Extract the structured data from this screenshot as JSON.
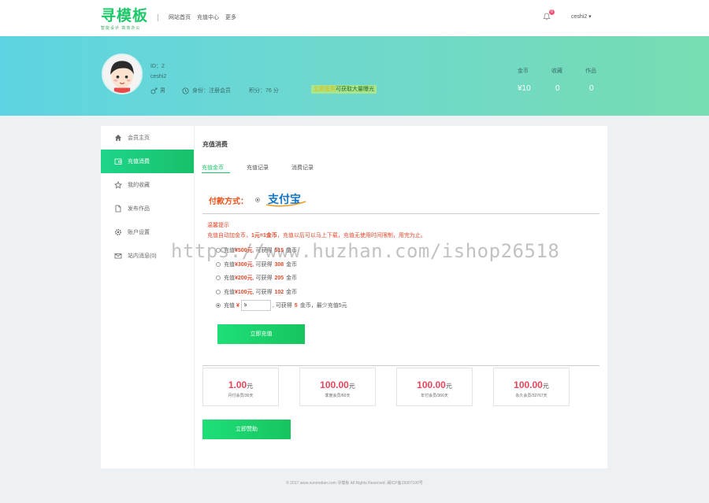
{
  "header": {
    "logo_text": "寻模板",
    "logo_sub": "智能设计 高效办公",
    "nav": [
      "网站首页",
      "充值中心",
      "更多"
    ],
    "notification_count": "0",
    "username": "ceshi2 ▾"
  },
  "profile": {
    "id": "ID：2",
    "name": "ceshi2",
    "gender": "男",
    "identity": "身份：注册会员",
    "points": "积分：76 分",
    "honor_hl": "立即签到",
    "honor_rest": "可获取大量曝光",
    "stats": [
      {
        "label": "金币",
        "value": "¥10"
      },
      {
        "label": "收藏",
        "value": "0"
      },
      {
        "label": "作品",
        "value": "0"
      }
    ]
  },
  "sidebar": {
    "items": [
      {
        "label": "会员主页",
        "icon": "home-icon"
      },
      {
        "label": "充值消费",
        "icon": "wallet-icon"
      },
      {
        "label": "我的收藏",
        "icon": "star-icon"
      },
      {
        "label": "发布作品",
        "icon": "file-icon"
      },
      {
        "label": "账户设置",
        "icon": "gear-icon"
      },
      {
        "label": "站内消息(0)",
        "icon": "mail-icon"
      }
    ]
  },
  "content": {
    "title": "充值消费",
    "tabs": [
      "充值金币",
      "充值记录",
      "消费记录"
    ],
    "pay_method_label": "付款方式：",
    "alipay_text": "支付宝",
    "tips_title": "温馨提示",
    "tips_pre": "充值自动加金币，",
    "tips_bold": "1元=1金币",
    "tips_post": "，充值以后可以马上下载，充值无使用时间限制，用完为止。",
    "options": [
      {
        "pre": "充值",
        "amount": "¥500元",
        "mid": ", 可获得",
        "coins": "515",
        "post": "金币"
      },
      {
        "pre": "充值",
        "amount": "¥300元",
        "mid": ", 可获得",
        "coins": "308",
        "post": "金币"
      },
      {
        "pre": "充值",
        "amount": "¥200元",
        "mid": ", 可获得",
        "coins": "205",
        "post": "金币"
      },
      {
        "pre": "充值",
        "amount": "¥100元",
        "mid": ", 可获得",
        "coins": "102",
        "post": "金币"
      }
    ],
    "custom_option": {
      "pre": "充值",
      "currency": "¥",
      "value": "5",
      "mid": ", 可获得",
      "coins": "5",
      "post": "金币，最少充值5元"
    },
    "recharge_button": "立即充值",
    "vip_plans": [
      {
        "price": "1.00",
        "unit": "元",
        "desc": "月付会员/30天"
      },
      {
        "price": "100.00",
        "unit": "元",
        "desc": "季度会员/60天"
      },
      {
        "price": "100.00",
        "unit": "元",
        "desc": "年付会员/366天"
      },
      {
        "price": "100.00",
        "unit": "元",
        "desc": "永久会员/32767天"
      }
    ],
    "sponsor_button": "立即赞助"
  },
  "watermark": "https://www.huzhan.com/ishop26518",
  "footer": "© 2017 www.xunmoban.com 寻模板 All Rights Reserved. 闽ICP备15007100号"
}
